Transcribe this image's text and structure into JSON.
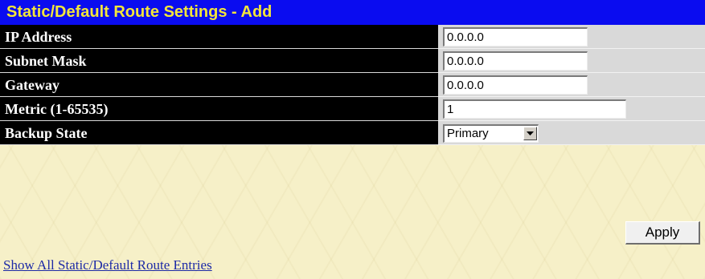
{
  "title": "Static/Default Route Settings - Add",
  "fields": [
    {
      "label": "IP Address",
      "value": "0.0.0.0"
    },
    {
      "label": "Subnet Mask",
      "value": "0.0.0.0"
    },
    {
      "label": "Gateway",
      "value": "0.0.0.0"
    },
    {
      "label": "Metric (1-65535)",
      "value": "1"
    },
    {
      "label": "Backup State",
      "selected": "Primary"
    }
  ],
  "apply_label": "Apply",
  "footer_link": "Show All Static/Default Route Entries",
  "colors": {
    "title_bg": "#0a0cf0",
    "title_text": "#f3e63a",
    "label_bg": "#000000",
    "value_bg": "#d9d9d9",
    "page_bg": "#f6f0c8",
    "link": "#1d2aa6"
  },
  "icons": {
    "dropdown": "chevron-down-icon"
  }
}
